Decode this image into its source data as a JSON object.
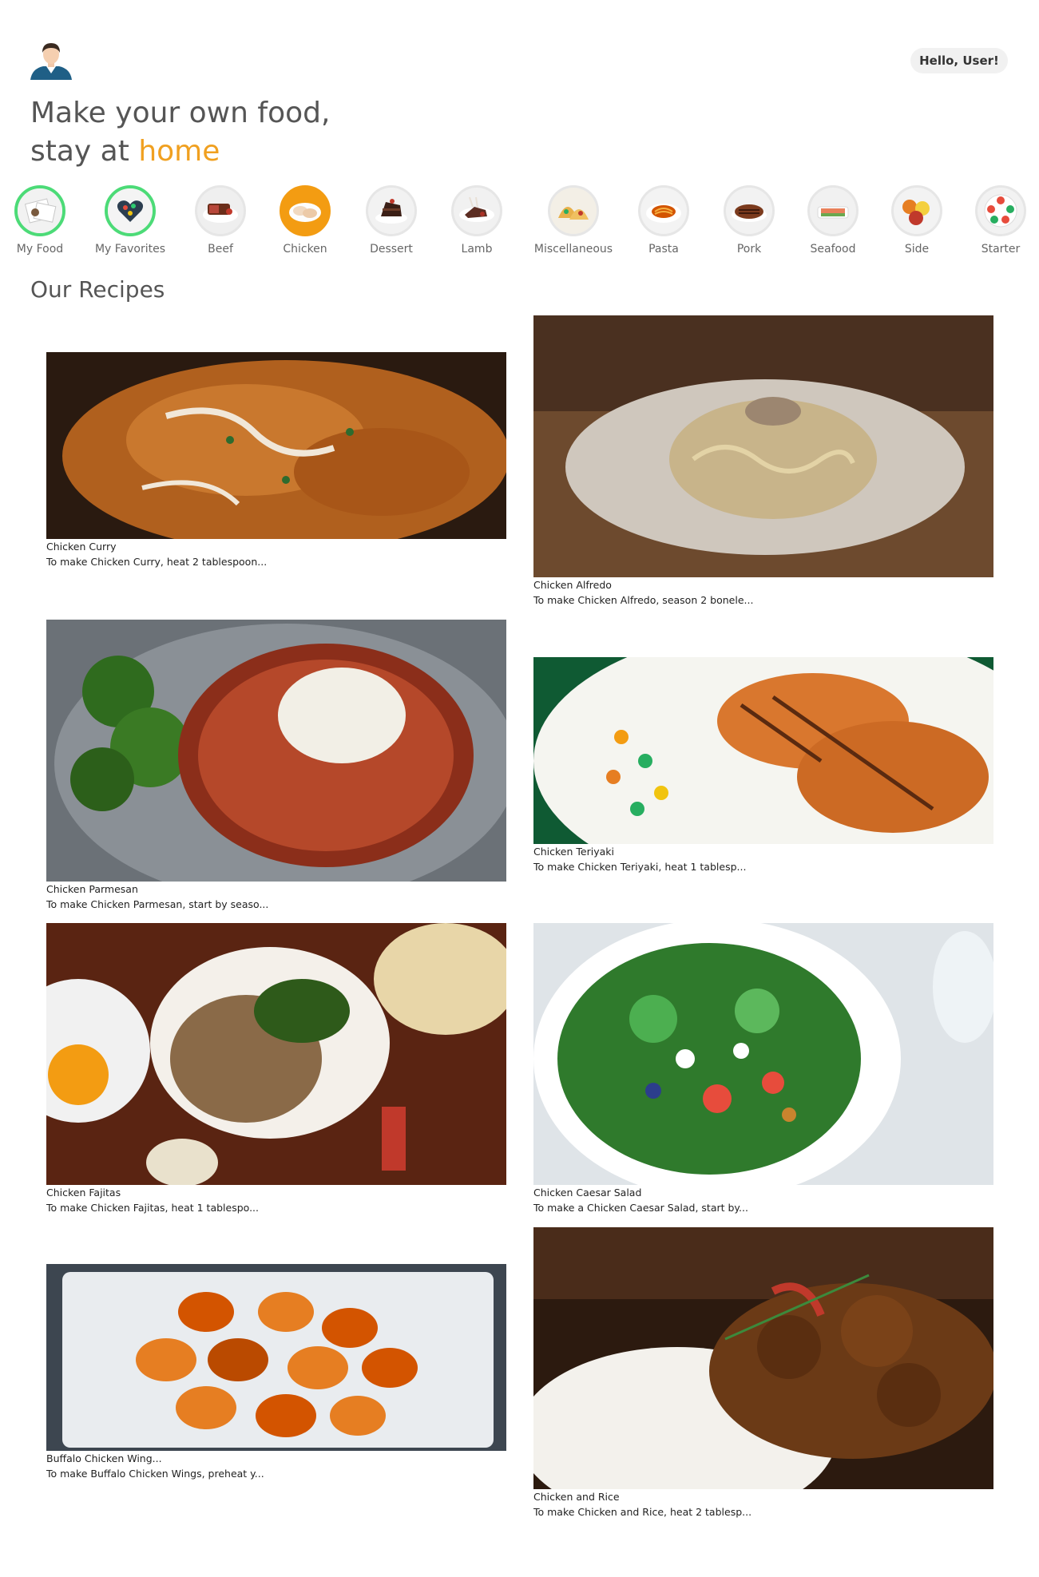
{
  "header": {
    "greeting": "Hello, User!",
    "headline_line1": "Make your own food,",
    "headline_line2_prefix": "stay at ",
    "headline_line2_accent": "home"
  },
  "categories": [
    {
      "label": "My Food",
      "icon": "my-food-icon"
    },
    {
      "label": "My Favorites",
      "icon": "heart-icon"
    },
    {
      "label": "Beef",
      "icon": "beef-icon"
    },
    {
      "label": "Chicken",
      "icon": "chicken-icon"
    },
    {
      "label": "Dessert",
      "icon": "dessert-icon"
    },
    {
      "label": "Lamb",
      "icon": "lamb-icon"
    },
    {
      "label": "Miscellaneous",
      "icon": "tacos-icon"
    },
    {
      "label": "Pasta",
      "icon": "pasta-icon"
    },
    {
      "label": "Pork",
      "icon": "pork-icon"
    },
    {
      "label": "Seafood",
      "icon": "seafood-icon"
    },
    {
      "label": "Side",
      "icon": "side-icon"
    },
    {
      "label": "Starter",
      "icon": "starter-icon"
    }
  ],
  "section_title": "Our Recipes",
  "recipes": [
    {
      "title": "Chicken Curry",
      "desc": "To make Chicken Curry, heat 2 tablespoon..."
    },
    {
      "title": "Chicken Alfredo",
      "desc": "To make Chicken Alfredo, season 2 bonele..."
    },
    {
      "title": "Chicken Parmesan",
      "desc": "To make Chicken Parmesan, start by seaso..."
    },
    {
      "title": "Chicken Teriyaki",
      "desc": "To make Chicken Teriyaki, heat 1 tablesp..."
    },
    {
      "title": "Chicken Fajitas",
      "desc": "To make Chicken Fajitas, heat 1 tablespo..."
    },
    {
      "title": "Chicken Caesar Salad",
      "desc": "To make a Chicken Caesar Salad, start by..."
    },
    {
      "title": "Buffalo Chicken Wing...",
      "desc": "To make Buffalo Chicken Wings, preheat y..."
    },
    {
      "title": "Chicken and Rice",
      "desc": "To make Chicken and Rice, heat 2 tablesp..."
    }
  ],
  "colors": {
    "accent": "#f0a020",
    "active_category": "#f39c12",
    "favorite_ring": "#4cdb77",
    "heading": "#555555"
  }
}
